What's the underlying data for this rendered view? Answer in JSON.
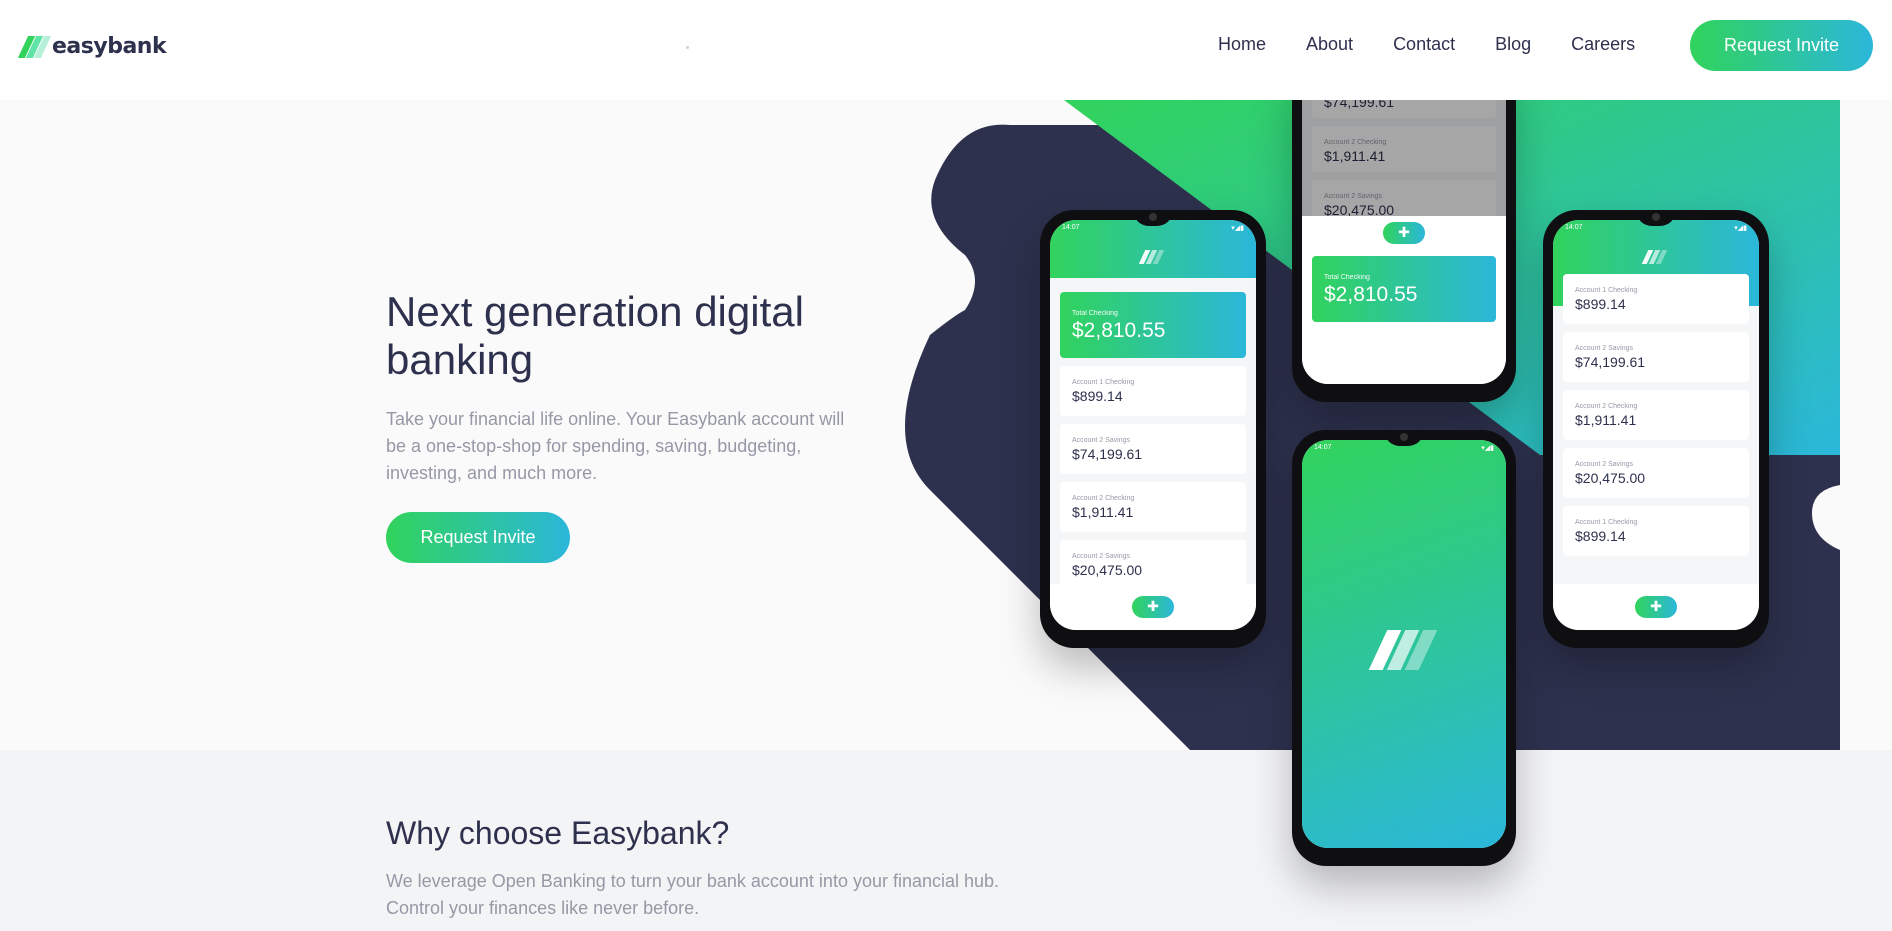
{
  "brand": {
    "name": "easybank"
  },
  "nav": {
    "items": [
      "Home",
      "About",
      "Contact",
      "Blog",
      "Careers"
    ],
    "cta_label": "Request Invite"
  },
  "hero": {
    "title": "Next generation digital banking",
    "text": "Take your financial life online. Your Easybank account will be a one-stop-shop for spending, saving, budgeting, investing, and much more.",
    "cta_label": "Request Invite"
  },
  "phones": {
    "status_time": "14:07",
    "total": {
      "label": "Total Checking",
      "amount": "$2,810.55"
    },
    "accounts": [
      {
        "label": "Account 1 Checking",
        "amount": "$899.14"
      },
      {
        "label": "Account 2 Savings",
        "amount": "$74,199.61"
      },
      {
        "label": "Account 2 Checking",
        "amount": "$1,911.41"
      },
      {
        "label": "Account 2 Savings",
        "amount": "$20,475.00"
      },
      {
        "label": "Account 1 Checking",
        "amount": "$899.14"
      }
    ]
  },
  "why": {
    "title": "Why choose Easybank?",
    "text": "We leverage Open Banking to turn your bank account into your financial hub. Control your finances like never before."
  },
  "colors": {
    "dark_blue": "#2d314d",
    "lime_green": "#31d35c",
    "bright_cyan": "#2bb7da",
    "grayish_blue": "#9698a6",
    "light_gray": "#fafafa"
  }
}
